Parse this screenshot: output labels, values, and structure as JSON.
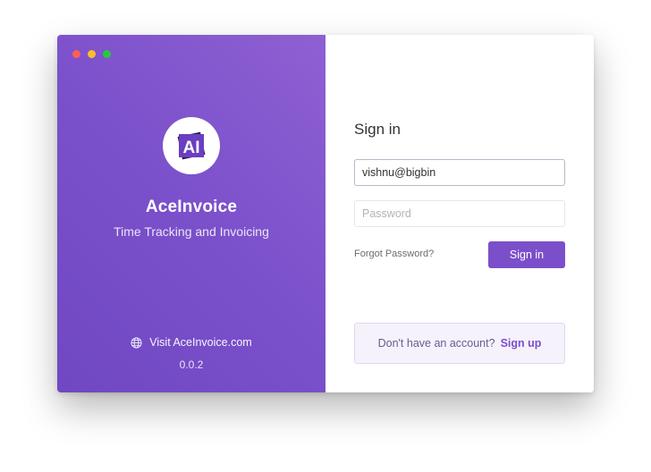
{
  "window": {
    "controls": [
      "close",
      "minimize",
      "zoom"
    ],
    "control_colors": {
      "close": "#fe5f57",
      "minimize": "#febc2e",
      "zoom": "#28c840"
    }
  },
  "brand": {
    "logo_text": "AI",
    "app_name": "AceInvoice",
    "tagline": "Time Tracking and Invoicing",
    "visit_label": "Visit AceInvoice.com",
    "version": "0.0.2",
    "accent_color": "#7b4fc9"
  },
  "signin": {
    "title": "Sign in",
    "email_value": "vishnu@bigbin",
    "password_placeholder": "Password",
    "forgot_label": "Forgot Password?",
    "button_label": "Sign in"
  },
  "signup": {
    "prompt": "Don't have an account?",
    "link_label": "Sign up"
  }
}
